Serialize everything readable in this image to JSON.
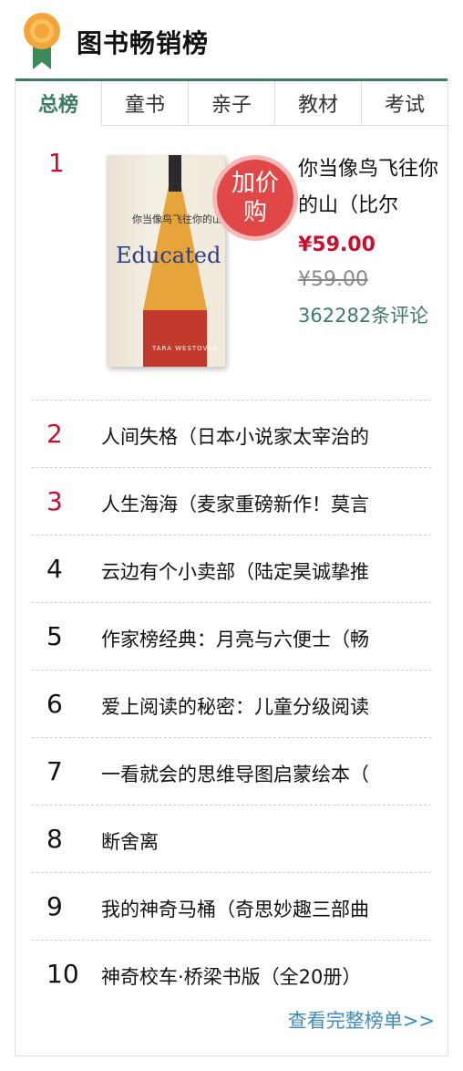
{
  "header": {
    "title": "图书畅销榜",
    "icon": "medal-icon"
  },
  "tabs": [
    "总榜",
    "童书",
    "亲子",
    "教材",
    "考试"
  ],
  "featured": {
    "rank": "1",
    "cover_title_cn": "你当像鸟飞往你的山",
    "cover_title_en": "Educated",
    "cover_author": "TARA WESTOVER",
    "badge": "加价购",
    "title": "你当像鸟飞往你的山（比尔",
    "price": "¥59.00",
    "old_price": "¥59.00",
    "reviews": "362282条评论"
  },
  "list": [
    {
      "rank": "2",
      "name": "人间失格（日本小说家太宰治的"
    },
    {
      "rank": "3",
      "name": "人生海海（麦家重磅新作！莫言"
    },
    {
      "rank": "4",
      "name": "云边有个小卖部（陆定昊诚挚推"
    },
    {
      "rank": "5",
      "name": "作家榜经典：月亮与六便士（畅"
    },
    {
      "rank": "6",
      "name": "爱上阅读的秘密：儿童分级阅读"
    },
    {
      "rank": "7",
      "name": "一看就会的思维导图启蒙绘本（"
    },
    {
      "rank": "8",
      "name": "断舍离"
    },
    {
      "rank": "9",
      "name": "我的神奇马桶（奇思妙趣三部曲"
    },
    {
      "rank": "10",
      "name": "神奇校车·桥梁书版（全20册）"
    }
  ],
  "more_link": "查看完整榜单>>",
  "colors": {
    "accent": "#3d7a66",
    "rank_red": "#c8102e",
    "badge": "#e04848",
    "link": "#3d8bb8"
  }
}
